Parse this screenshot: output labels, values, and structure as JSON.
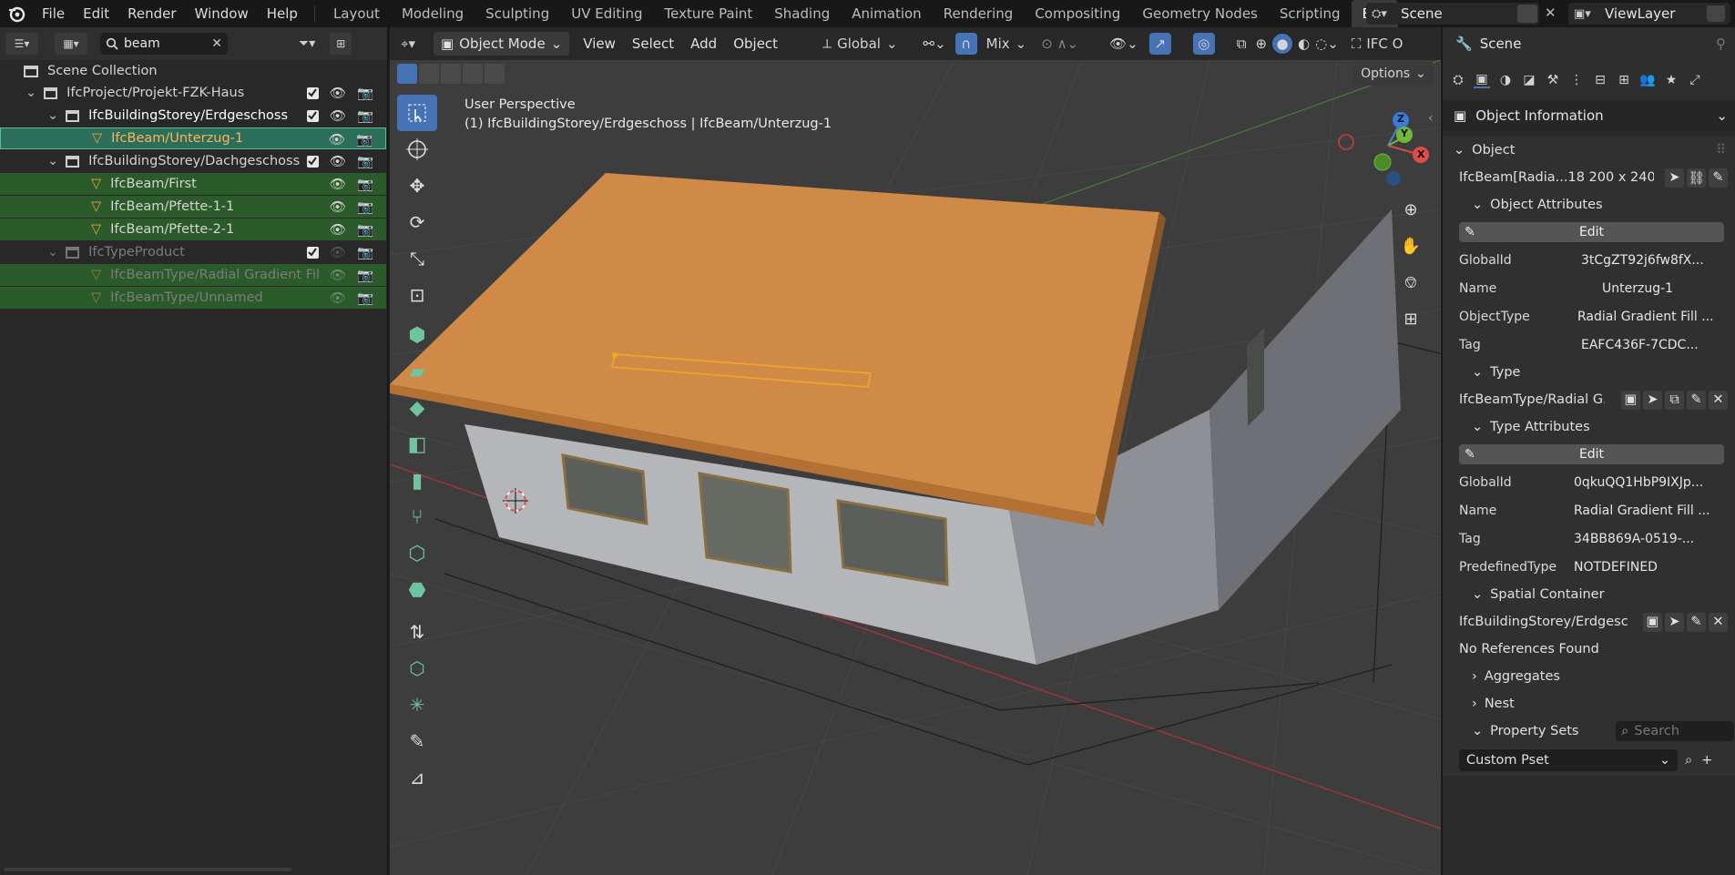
{
  "menu": {
    "file": "File",
    "edit": "Edit",
    "render": "Render",
    "window": "Window",
    "help": "Help"
  },
  "workspaces": [
    "Layout",
    "Modeling",
    "Sculpting",
    "UV Editing",
    "Texture Paint",
    "Shading",
    "Animation",
    "Rendering",
    "Compositing",
    "Geometry Nodes",
    "Scripting",
    "BIM"
  ],
  "active_workspace": "BIM",
  "scene_name": "Scene",
  "view_layer": "ViewLayer",
  "outliner": {
    "search_value": "beam",
    "rows": [
      {
        "label": "Scene Collection"
      },
      {
        "label": "IfcProject/Projekt-FZK-Haus"
      },
      {
        "label": "IfcBuildingStorey/Erdgeschoss"
      },
      {
        "label": "IfcBeam/Unterzug-1"
      },
      {
        "label": "IfcBuildingStorey/Dachgeschoss"
      },
      {
        "label": "IfcBeam/First"
      },
      {
        "label": "IfcBeam/Pfette-1-1"
      },
      {
        "label": "IfcBeam/Pfette-2-1"
      },
      {
        "label": "IfcTypeProduct"
      },
      {
        "label": "IfcBeamType/Radial Gradient Fil"
      },
      {
        "label": "IfcBeamType/Unnamed"
      }
    ]
  },
  "viewport": {
    "mode": "Object Mode",
    "menus": [
      "View",
      "Select",
      "Add",
      "Object"
    ],
    "orientation": "Global",
    "pivot": "Mix",
    "ifc_label": "IFC O",
    "options": "Options",
    "view_name": "User Perspective",
    "view_info": "(1) IfcBuildingStorey/Erdgeschoss | IfcBeam/Unterzug-1",
    "gizmo": {
      "x": "X",
      "y": "Y",
      "z": "Z"
    }
  },
  "properties": {
    "header": "Scene",
    "panel": "Object Information",
    "object_section": "Object",
    "object_name": "IfcBeam[Radia...18 200 x 240]",
    "object_attributes": "Object Attributes",
    "edit": "Edit",
    "attrs": [
      {
        "k": "GlobalId",
        "v": "3tCgZT92j6fw8fX..."
      },
      {
        "k": "Name",
        "v": "Unterzug-1"
      },
      {
        "k": "ObjectType",
        "v": "Radial Gradient Fill ..."
      },
      {
        "k": "Tag",
        "v": "EAFC436F-7CDC..."
      }
    ],
    "type_section": "Type",
    "type_name": "IfcBeamType/Radial G...",
    "type_attributes": "Type Attributes",
    "type_attrs": [
      {
        "k": "GlobalId",
        "v": "0qkuQQ1HbP9IXJp..."
      },
      {
        "k": "Name",
        "v": "Radial Gradient Fill ..."
      },
      {
        "k": "Tag",
        "v": "34BB869A-0519-..."
      },
      {
        "k": "PredefinedType",
        "v": "NOTDEFINED"
      }
    ],
    "spatial_container": "Spatial Container",
    "container_name": "IfcBuildingStorey/Erdgesc...",
    "no_refs": "No References Found",
    "aggregates": "Aggregates",
    "nest": "Nest",
    "property_sets": "Property Sets",
    "pset_search_placeholder": "Search",
    "pset_select": "Custom Pset"
  },
  "colors": {
    "accent": "#4772b3",
    "selection": "#f5a623",
    "roof": "#cf8a48",
    "outliner_highlight": "#2b5a2b"
  }
}
